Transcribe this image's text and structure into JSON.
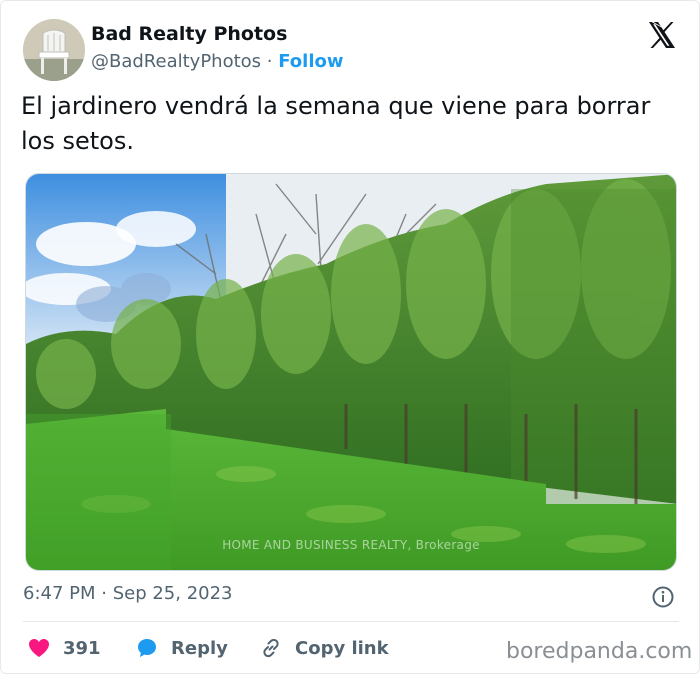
{
  "tweet": {
    "author_name": "Bad Realty Photos",
    "author_handle": "@BadRealtyPhotos",
    "separator": " · ",
    "follow_label": "Follow",
    "text": "El jardinero vendrá la semana que viene para borrar los setos.",
    "image_watermark": "HOME AND BUSINESS REALTY, Brokerage",
    "timestamp_time": "6:47 PM",
    "timestamp_date": "Sep 25, 2023",
    "likes_count": "391",
    "reply_label": "Reply",
    "copy_link_label": "Copy link"
  },
  "footer": {
    "brand": "boredpanda.com"
  },
  "icons": {
    "platform": "x-logo-icon",
    "info": "info-icon",
    "like": "heart-icon",
    "reply": "speech-bubble-icon",
    "copy": "link-icon"
  },
  "colors": {
    "accent": "#1d9bf0",
    "like": "#f91880",
    "text_primary": "#0f1419",
    "text_secondary": "#536471"
  }
}
